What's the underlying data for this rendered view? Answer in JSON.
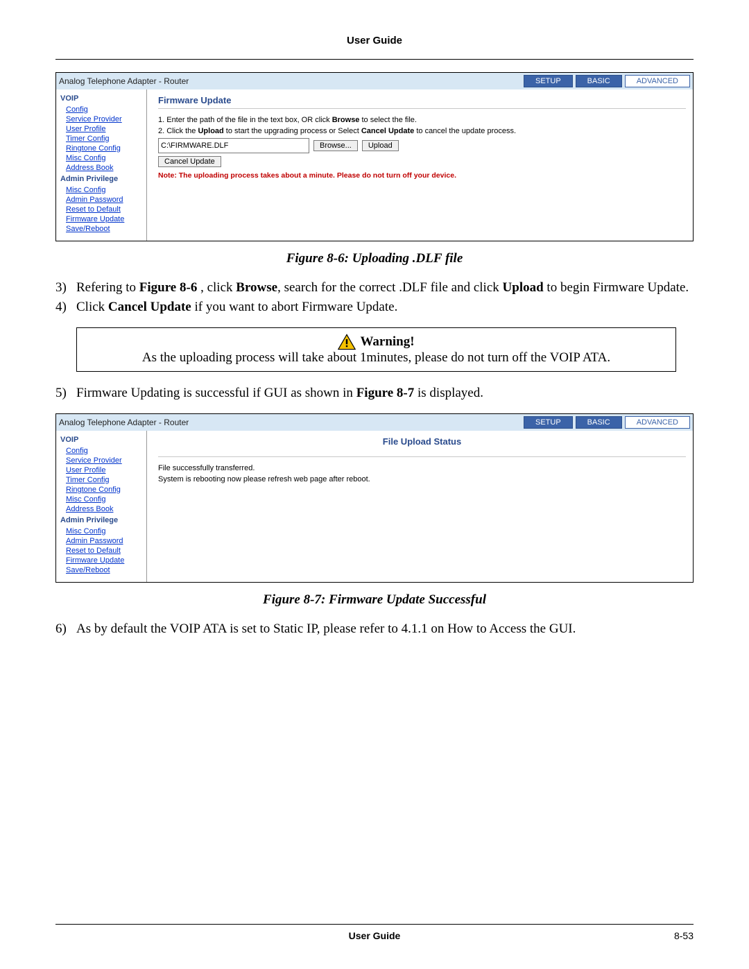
{
  "header": {
    "title": "User Guide"
  },
  "footer": {
    "title": "User Guide",
    "page": "8-53"
  },
  "captions": {
    "fig86": "Figure 8-6: Uploading .DLF file",
    "fig87": "Figure 8-7: Firmware Update Successful"
  },
  "steps": {
    "s3_num": "3)",
    "s3_a": "Refering to ",
    "s3_b": "Figure 8-6",
    "s3_c": " , click ",
    "s3_d": "Browse",
    "s3_e": ", search for the correct .DLF file and click ",
    "s3_f": "Upload",
    "s3_g": " to begin Firmware Update.",
    "s4_num": "4)",
    "s4_a": "Click ",
    "s4_b": "Cancel Update",
    "s4_c": " if you want to abort Firmware Update.",
    "s5_num": "5)",
    "s5_a": "Firmware Updating is successful if GUI as shown in ",
    "s5_b": "Figure 8-7",
    "s5_c": " is displayed.",
    "s6_num": "6)",
    "s6_a": "As by default the VOIP ATA is set to Static IP, please refer to 4.1.1 on How to Access the GUI."
  },
  "warning": {
    "label": "Warning!",
    "text": "As the uploading process will take about 1minutes, please do not turn off the VOIP ATA."
  },
  "router_common": {
    "title": "Analog Telephone Adapter - Router",
    "tabs": {
      "setup": "SETUP",
      "basic": "BASIC",
      "advanced": "ADVANCED"
    },
    "sidebar": {
      "voip_label": "VOIP",
      "items_voip": [
        "Config",
        "Service Provider",
        "User Profile",
        "Timer Config",
        "Ringtone Config",
        "Misc Config",
        "Address Book"
      ],
      "admin_label": "Admin Privilege",
      "items_admin": [
        "Misc Config",
        "Admin Password",
        "Reset to Default",
        "Firmware Update",
        "Save/Reboot"
      ]
    }
  },
  "fig86": {
    "heading": "Firmware Update",
    "instr1_a": "1. Enter the path of the file in the text box, OR click ",
    "instr1_b": "Browse",
    "instr1_c": " to select the file.",
    "instr2_a": "2. Click the ",
    "instr2_b": "Upload",
    "instr2_c": " to start the upgrading process or Select ",
    "instr2_d": "Cancel Update",
    "instr2_e": " to cancel the update process.",
    "path_value": "C:\\FIRMWARE.DLF",
    "browse_btn": "Browse...",
    "upload_btn": "Upload",
    "cancel_btn": "Cancel Update",
    "note": "Note: The uploading process takes about a minute. Please do not turn off your device."
  },
  "fig87": {
    "heading": "File Upload Status",
    "line1": "File successfully transferred.",
    "line2": "System is rebooting now please refresh web page after reboot."
  }
}
